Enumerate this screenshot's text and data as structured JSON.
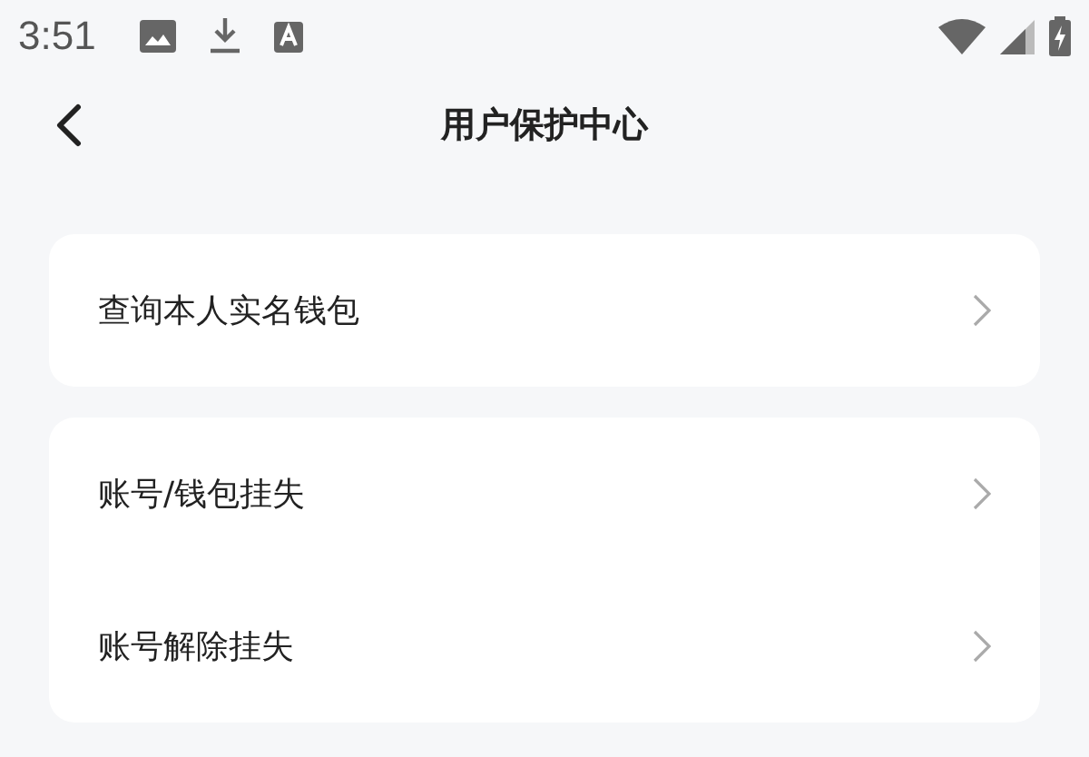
{
  "status_bar": {
    "time": "3:51"
  },
  "header": {
    "title": "用户保护中心"
  },
  "groups": [
    {
      "items": [
        {
          "label": "查询本人实名钱包"
        }
      ]
    },
    {
      "items": [
        {
          "label": "账号/钱包挂失"
        },
        {
          "label": "账号解除挂失"
        }
      ]
    }
  ]
}
